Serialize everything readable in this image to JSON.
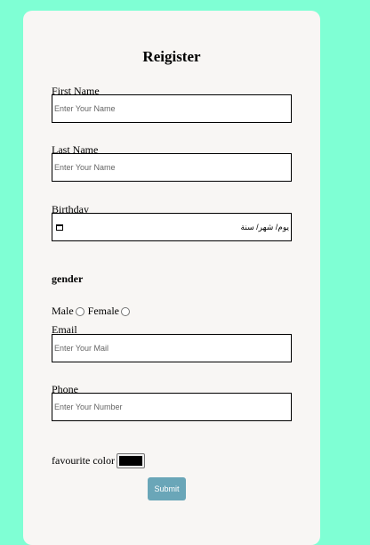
{
  "form": {
    "title": "Reigister",
    "first_name": {
      "label": "First Name",
      "placeholder": "Enter Your Name"
    },
    "last_name": {
      "label": "Last Name",
      "placeholder": "Enter Your Name"
    },
    "birthday": {
      "label": "Birthday",
      "placeholder": "يوم/ شهر/ سنة"
    },
    "gender": {
      "heading": "gender",
      "male_label": "Male",
      "female_label": "Female"
    },
    "email": {
      "label": "Email",
      "placeholder": "Enter Your Mail"
    },
    "phone": {
      "label": "Phone",
      "placeholder": "Enter Your Number"
    },
    "favourite_color": {
      "label": "favourite color",
      "value": "#000000"
    },
    "submit_label": "Submit"
  },
  "colors": {
    "background": "#7fffd4",
    "card": "#f8f6f4",
    "submit": "#6aa6b8"
  }
}
